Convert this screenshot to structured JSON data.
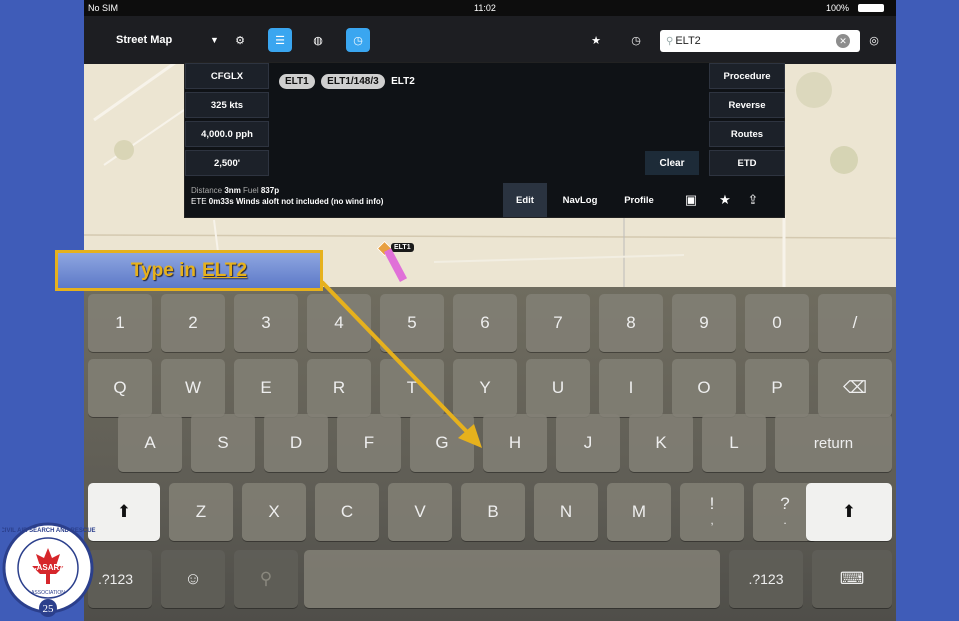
{
  "status": {
    "carrier": "No SIM",
    "time": "11:02",
    "battery": "100%"
  },
  "toolbar": {
    "map_select": "Street Map",
    "search_value": "ELT2"
  },
  "panel": {
    "left_buttons": [
      "CFGLX",
      "325 kts",
      "4,000.0 pph",
      "2,500'"
    ],
    "right_buttons": [
      "Procedure",
      "Reverse",
      "Routes",
      "ETD"
    ],
    "route_pills": [
      "ELT1",
      "ELT1/148/3"
    ],
    "route_text": "ELT2",
    "clear_label": "Clear",
    "info_line1_label": "Distance",
    "info_line1_dist": "3nm",
    "info_line1_fuel_label": "Fuel",
    "info_line1_fuel": "837p",
    "info_line2_label": "ETE",
    "info_line2_ete": "0m33s",
    "info_line2_note": "Winds aloft not included (no wind info)",
    "tabs": [
      "Edit",
      "NavLog",
      "Profile"
    ]
  },
  "map": {
    "waypoint_label": "ELT1"
  },
  "callout": {
    "prefix": "Type in",
    "target": "ELT2"
  },
  "keyboard": {
    "row1": [
      "1",
      "2",
      "3",
      "4",
      "5",
      "6",
      "7",
      "8",
      "9",
      "0",
      "/"
    ],
    "row2": [
      "Q",
      "W",
      "E",
      "R",
      "T",
      "Y",
      "U",
      "I",
      "O",
      "P"
    ],
    "row3": [
      "A",
      "S",
      "D",
      "F",
      "G",
      "H",
      "J",
      "K",
      "L"
    ],
    "return_label": "return",
    "row4": [
      "Z",
      "X",
      "C",
      "V",
      "B",
      "N",
      "M"
    ],
    "punct1": "!",
    "punct1_sub": ",",
    "punct2": "?",
    "punct2_sub": ".",
    "numeric_label": ".?123"
  },
  "logo": {
    "text": "CIVIL AIR SEARCH AND RESCUE",
    "name": "CASARA",
    "sub": "ASSOCIATION",
    "years": "25"
  },
  "colors": {
    "accent": "#3aa6f0",
    "callout_border": "#e6b11d",
    "route_magenta": "#e070d8",
    "background": "#3f5cb8"
  }
}
